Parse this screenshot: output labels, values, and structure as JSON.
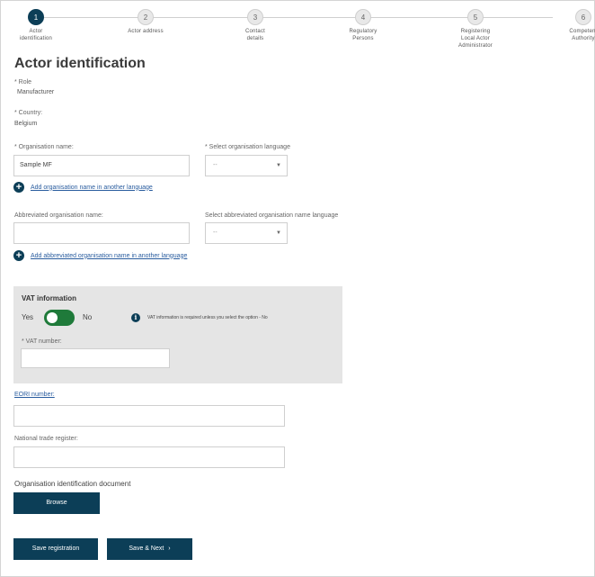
{
  "steps": [
    {
      "num": "1",
      "label_lines": [
        "Actor",
        "identification"
      ]
    },
    {
      "num": "2",
      "label_lines": [
        "Actor address"
      ]
    },
    {
      "num": "3",
      "label_lines": [
        "Contact",
        "details"
      ]
    },
    {
      "num": "4",
      "label_lines": [
        "Regulatory",
        "Persons"
      ]
    },
    {
      "num": "5",
      "label_lines": [
        "Registering",
        "Local Actor",
        "Administrator"
      ]
    },
    {
      "num": "6",
      "label_lines": [
        "Competent",
        "Authority"
      ]
    }
  ],
  "page_title": "Actor identification",
  "role": {
    "label": "* Role",
    "value": "Manufacturer"
  },
  "country": {
    "label": "* Country:",
    "value": "Belgium"
  },
  "org_name": {
    "label": "* Organisation name:",
    "value": "Sample MF"
  },
  "org_lang": {
    "label": "* Select organisation language",
    "value": "--"
  },
  "add_org_name_link": "Add organisation name in another language",
  "abbr_name": {
    "label": "Abbreviated organisation name:",
    "value": ""
  },
  "abbr_lang": {
    "label": "Select abbreviated organisation name language",
    "value": "--"
  },
  "add_abbr_link": "Add abbreviated organisation name in another language",
  "vat": {
    "title": "VAT information",
    "yes": "Yes",
    "no": "No",
    "toggle_state": "yes",
    "info_text": "VAT information is required unless you select the option - No",
    "number_label": "* VAT number:",
    "number_value": ""
  },
  "eori": {
    "label": "EORI number:",
    "value": ""
  },
  "ntr": {
    "label": "National trade register:",
    "value": ""
  },
  "doc": {
    "label": "Organisation identification document",
    "browse": "Browse"
  },
  "buttons": {
    "save": "Save registration",
    "next": "Save & Next"
  },
  "colors": {
    "primary": "#0c3e57",
    "toggle_on": "#1f7a3a",
    "link": "#2a5d9f"
  }
}
